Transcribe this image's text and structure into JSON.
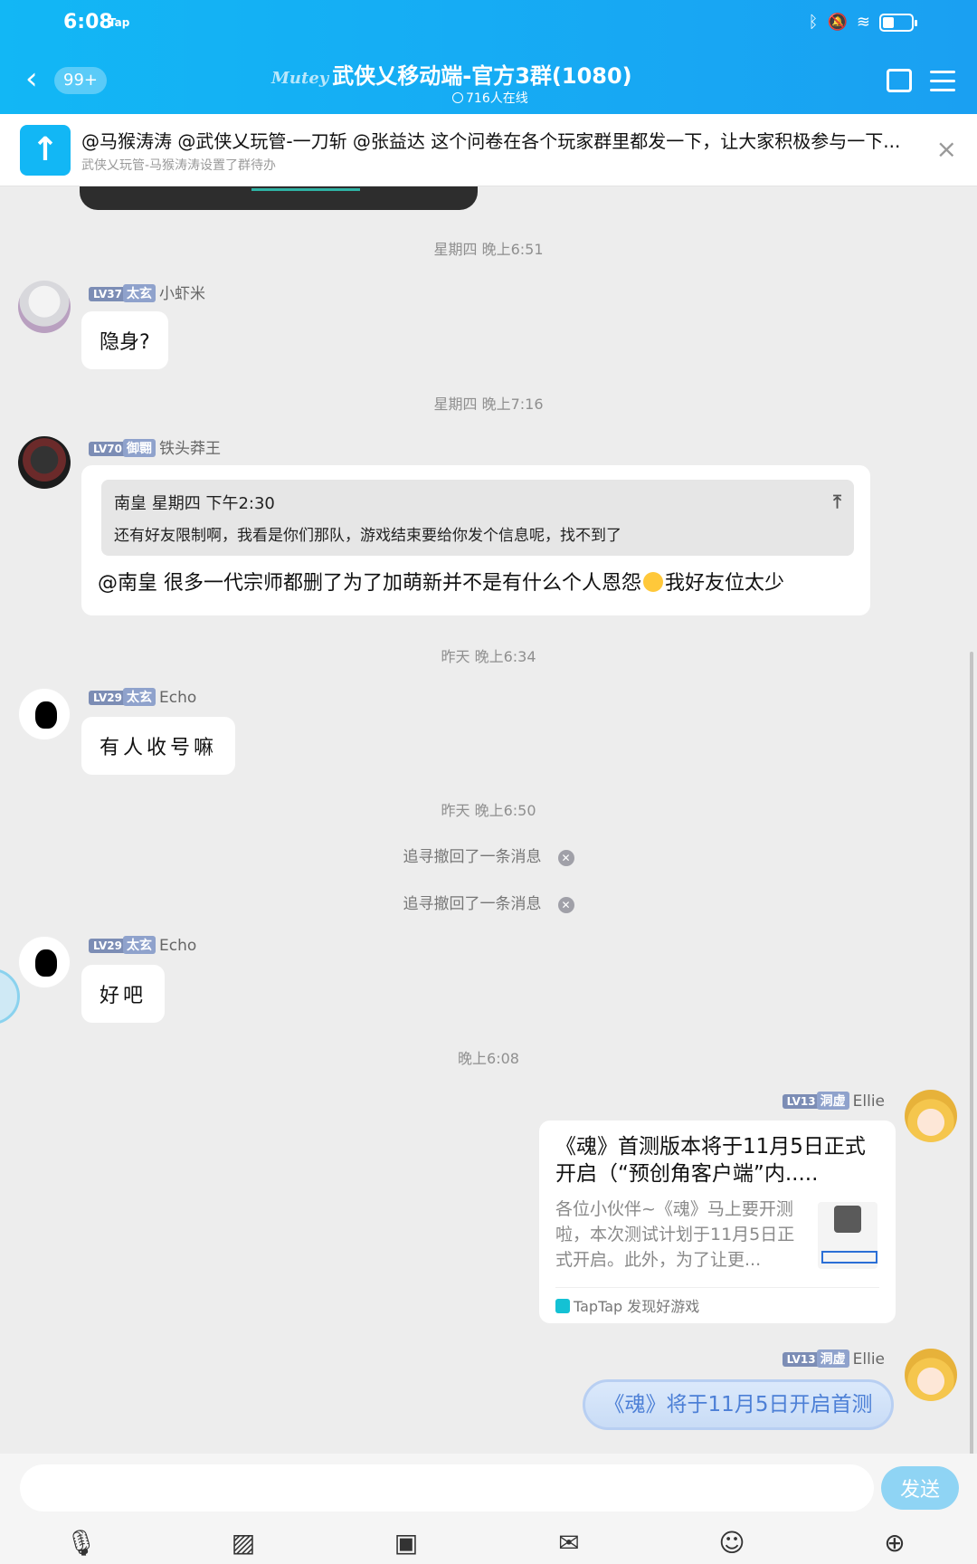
{
  "status": {
    "time": "6:08",
    "tap": "Tap"
  },
  "header": {
    "back_icon": "chevron-left-icon",
    "unread": "99+",
    "deco": "Mutey",
    "title": "武侠乂移动端-官方3群(1080)",
    "online": "716人在线"
  },
  "notice": {
    "text": "@马猴涛涛 @武侠乂玩管-一刀斩 @张益达 这个问卷在各个玩家群里都发一下，让大家积极参与一下...",
    "sub": "武侠乂玩管-马猴涛涛设置了群待办",
    "close": "×"
  },
  "messages": {
    "t1": "星期四 晚上6:51",
    "m1": {
      "lv": "LV37",
      "rank": "太玄",
      "name": "小虾米",
      "text": "隐身?"
    },
    "t2": "星期四 晚上7:16",
    "m2": {
      "lv": "LV70",
      "rank": "御翾",
      "name": "铁头莽王",
      "quote_head": "南皇 星期四 下午2:30",
      "quote_body": "还有好友限制啊，我看是你们那队，游戏结束要给你发个信息呢，找不到了",
      "text_a": "@南皇 很多一代宗师都删了为了加萌新并不是有什么个人恩怨",
      "text_b": "我好友位太少"
    },
    "t3": "昨天 晚上6:34",
    "m3": {
      "lv": "LV29",
      "rank": "太玄",
      "name": "Echo",
      "text": "有人收号嘛"
    },
    "t4": "昨天 晚上6:50",
    "recall1": "追寻撤回了一条消息",
    "recall2": "追寻撤回了一条消息",
    "m4": {
      "lv": "LV29",
      "rank": "太玄",
      "name": "Echo",
      "text": "好吧"
    },
    "t5": "晚上6:08",
    "m5": {
      "lv": "LV13",
      "rank": "洞虚",
      "name": "Ellie",
      "card_title": "《魂》首测版本将于11月5日正式开启（“预创角客户端”内.....",
      "card_desc": "各位小伙伴~《魂》马上要开测啦，本次测试计划于11月5日正式开启。此外，为了让更...",
      "card_source": "TapTap 发现好游戏"
    },
    "m6": {
      "lv": "LV13",
      "rank": "洞虚",
      "name": "Ellie",
      "text": "《魂》将于11月5日开启首测"
    }
  },
  "bottom": {
    "send": "发送",
    "tools": [
      "mic-icon",
      "image-icon",
      "camera-icon",
      "gift-icon",
      "emoji-icon",
      "plus-icon"
    ]
  },
  "colors": {
    "header": "#12b7f5",
    "send": "#8fd4f4",
    "link": "#4c7fd6"
  }
}
